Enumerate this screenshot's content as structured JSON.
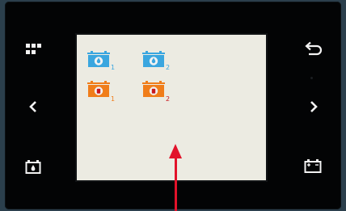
{
  "colors": {
    "frame": "#2b3f4c",
    "bezel": "#030405",
    "screen": "#ecebe2",
    "icon": "#f2f2f2",
    "water_tank": "#3aa6df",
    "fuel_tank": "#f07d1a",
    "tank_mark": "#c8171d",
    "annotation_arrow": "#e2122a"
  },
  "left_buttons": [
    {
      "icon": "grid-icon"
    },
    {
      "icon": "chevron-left-icon"
    },
    {
      "icon": "water-tank-icon"
    }
  ],
  "right_buttons": [
    {
      "icon": "back-arrow-icon"
    },
    {
      "icon": "chevron-right-icon"
    },
    {
      "icon": "battery-icon"
    }
  ],
  "tanks": [
    {
      "kind": "water",
      "label": "1"
    },
    {
      "kind": "water",
      "label": "2"
    },
    {
      "kind": "fuel",
      "label": "1"
    },
    {
      "kind": "fuel",
      "label": "2"
    }
  ]
}
